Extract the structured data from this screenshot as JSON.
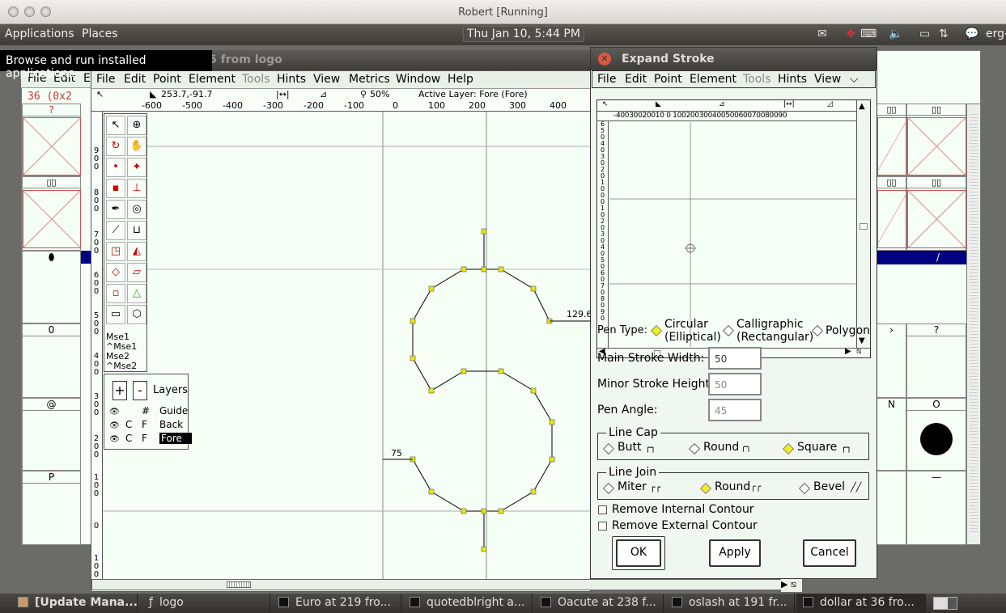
{
  "vm_window": {
    "title": "Robert [Running]"
  },
  "panel": {
    "applications": "Applications",
    "places": "Places",
    "clock": "Thu Jan 10,  5:44 PM",
    "user": "erg-"
  },
  "tooltip": "Browse and run installed applications",
  "font_view": {
    "title_fragment": "5 from logo",
    "menu": [
      "File",
      "Edit",
      "E"
    ],
    "encoding_fragment": "36  (0x2",
    "glyph_labels": [
      "?",
      "0",
      "@",
      "P"
    ],
    "right_labels": [
      "?",
      "O",
      "/",
      "—"
    ]
  },
  "char_view": {
    "menu": {
      "file": "File",
      "edit": "Edit",
      "point": "Point",
      "element": "Element",
      "tools": "Tools",
      "hints": "Hints",
      "view": "View",
      "metrics": "Metrics",
      "window": "Window",
      "help": "Help"
    },
    "info": {
      "coords": "253.7,-91.7",
      "zoom": "50%",
      "active_layer": "Active Layer: Fore (Fore)"
    },
    "ruler_labels": [
      "-600",
      "-500",
      "-400",
      "-300",
      "-200",
      "-100",
      "0",
      "100",
      "200",
      "300",
      "400"
    ],
    "measure_right": "129.6",
    "measure_left": "75"
  },
  "tools": {
    "mse1": "Mse1",
    "mse1c": "^Mse1",
    "mse2": "Mse2",
    "mse2c": "^Mse2"
  },
  "layers": {
    "title": "Layers",
    "add": "+",
    "remove": "-",
    "rows": [
      {
        "eye": "👁",
        "c": "",
        "f": "#",
        "name": "Guide"
      },
      {
        "eye": "👁",
        "c": "C",
        "f": "F",
        "name": "Back"
      },
      {
        "eye": "👁",
        "c": "C",
        "f": "F",
        "name": "Fore"
      }
    ]
  },
  "dialog": {
    "title": "Expand Stroke",
    "menu": {
      "file": "File",
      "edit": "Edit",
      "point": "Point",
      "element": "Element",
      "tools": "Tools",
      "hints": "Hints",
      "view": "View"
    },
    "preview_ruler": "-40030020010 0  10020030040050060070080090",
    "pen_type_label": "Pen Type:",
    "pen_types": [
      {
        "line1": "Circular",
        "line2": "(Elliptical)",
        "selected": true
      },
      {
        "line1": "Calligraphic",
        "line2": "(Rectangular)",
        "selected": false
      },
      {
        "line1": "Polygon",
        "line2": "",
        "selected": false
      }
    ],
    "main_stroke_width_label": "Main Stroke Width:",
    "main_stroke_width": "50",
    "minor_stroke_height_label": "Minor Stroke Height:",
    "minor_stroke_height": "50",
    "pen_angle_label": "Pen Angle:",
    "pen_angle": "45",
    "line_cap": {
      "title": "Line Cap",
      "options": [
        "Butt",
        "Round",
        "Square"
      ],
      "selected": "Square"
    },
    "line_join": {
      "title": "Line Join",
      "options": [
        "Miter",
        "Round",
        "Bevel"
      ],
      "selected": "Round"
    },
    "remove_internal": "Remove Internal Contour",
    "remove_external": "Remove External Contour",
    "ok": "OK",
    "apply": "Apply",
    "cancel": "Cancel"
  },
  "taskbar": [
    {
      "label": "[Update Mana..."
    },
    {
      "label": "logo"
    },
    {
      "label": "Euro at 219 fro..."
    },
    {
      "label": "quotedblright a..."
    },
    {
      "label": "Oacute at 238 f..."
    },
    {
      "label": "oslash at 191 fr..."
    },
    {
      "label": "dollar at 36 fro..."
    }
  ],
  "colors": {
    "accent_select": "#000080",
    "handle": "#e8e800",
    "canvas": "#f5fff5"
  }
}
